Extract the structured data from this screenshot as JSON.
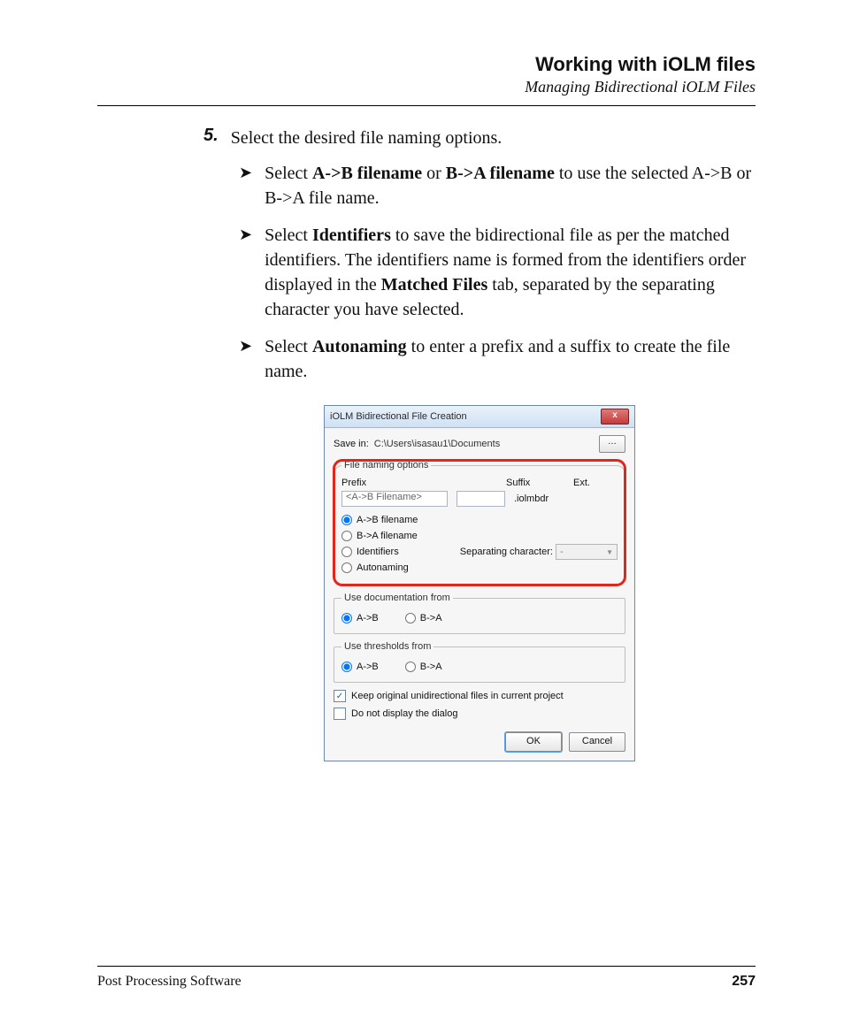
{
  "header": {
    "title": "Working with iOLM files",
    "subtitle": "Managing Bidirectional iOLM Files"
  },
  "step": {
    "num": "5.",
    "text": "Select the desired file naming options."
  },
  "bullets": {
    "b1": {
      "pre": "Select ",
      "bold1": "A->B filename",
      "mid": " or ",
      "bold2": "B->A filename",
      "post": " to use the selected A->B or B->A file name."
    },
    "b2": {
      "pre": "Select ",
      "bold1": "Identifiers",
      "mid1": " to save the bidirectional file as per the matched identifiers. The identifiers name is formed from the identifiers order displayed in the ",
      "bold2": "Matched Files",
      "post": " tab, separated by the separating character you have selected."
    },
    "b3": {
      "pre": "Select ",
      "bold1": "Autonaming",
      "post": " to enter a prefix and a suffix to create the file name."
    }
  },
  "dialog": {
    "title": "iOLM Bidirectional File Creation",
    "close": "x",
    "save_label": "Save in:",
    "save_path": "C:\\Users\\isasau1\\Documents",
    "browse": "…",
    "group_naming": "File naming options",
    "lab_prefix": "Prefix",
    "lab_suffix": "Suffix",
    "lab_ext": "Ext.",
    "prefix_val": "<A->B Filename>",
    "ext_val": ".iolmbdr",
    "r_ab": "A->B filename",
    "r_ba": "B->A filename",
    "r_id": "Identifiers",
    "r_auto": "Autonaming",
    "sep_label": "Separating character:",
    "sep_val": "-",
    "group_doc": "Use documentation from",
    "group_thr": "Use thresholds from",
    "opt_ab": "A->B",
    "opt_ba": "B->A",
    "cb_keep": "Keep original unidirectional files in current project",
    "cb_hide": "Do not display the dialog",
    "ok": "OK",
    "cancel": "Cancel"
  },
  "footer": {
    "left": "Post Processing Software",
    "page": "257"
  }
}
